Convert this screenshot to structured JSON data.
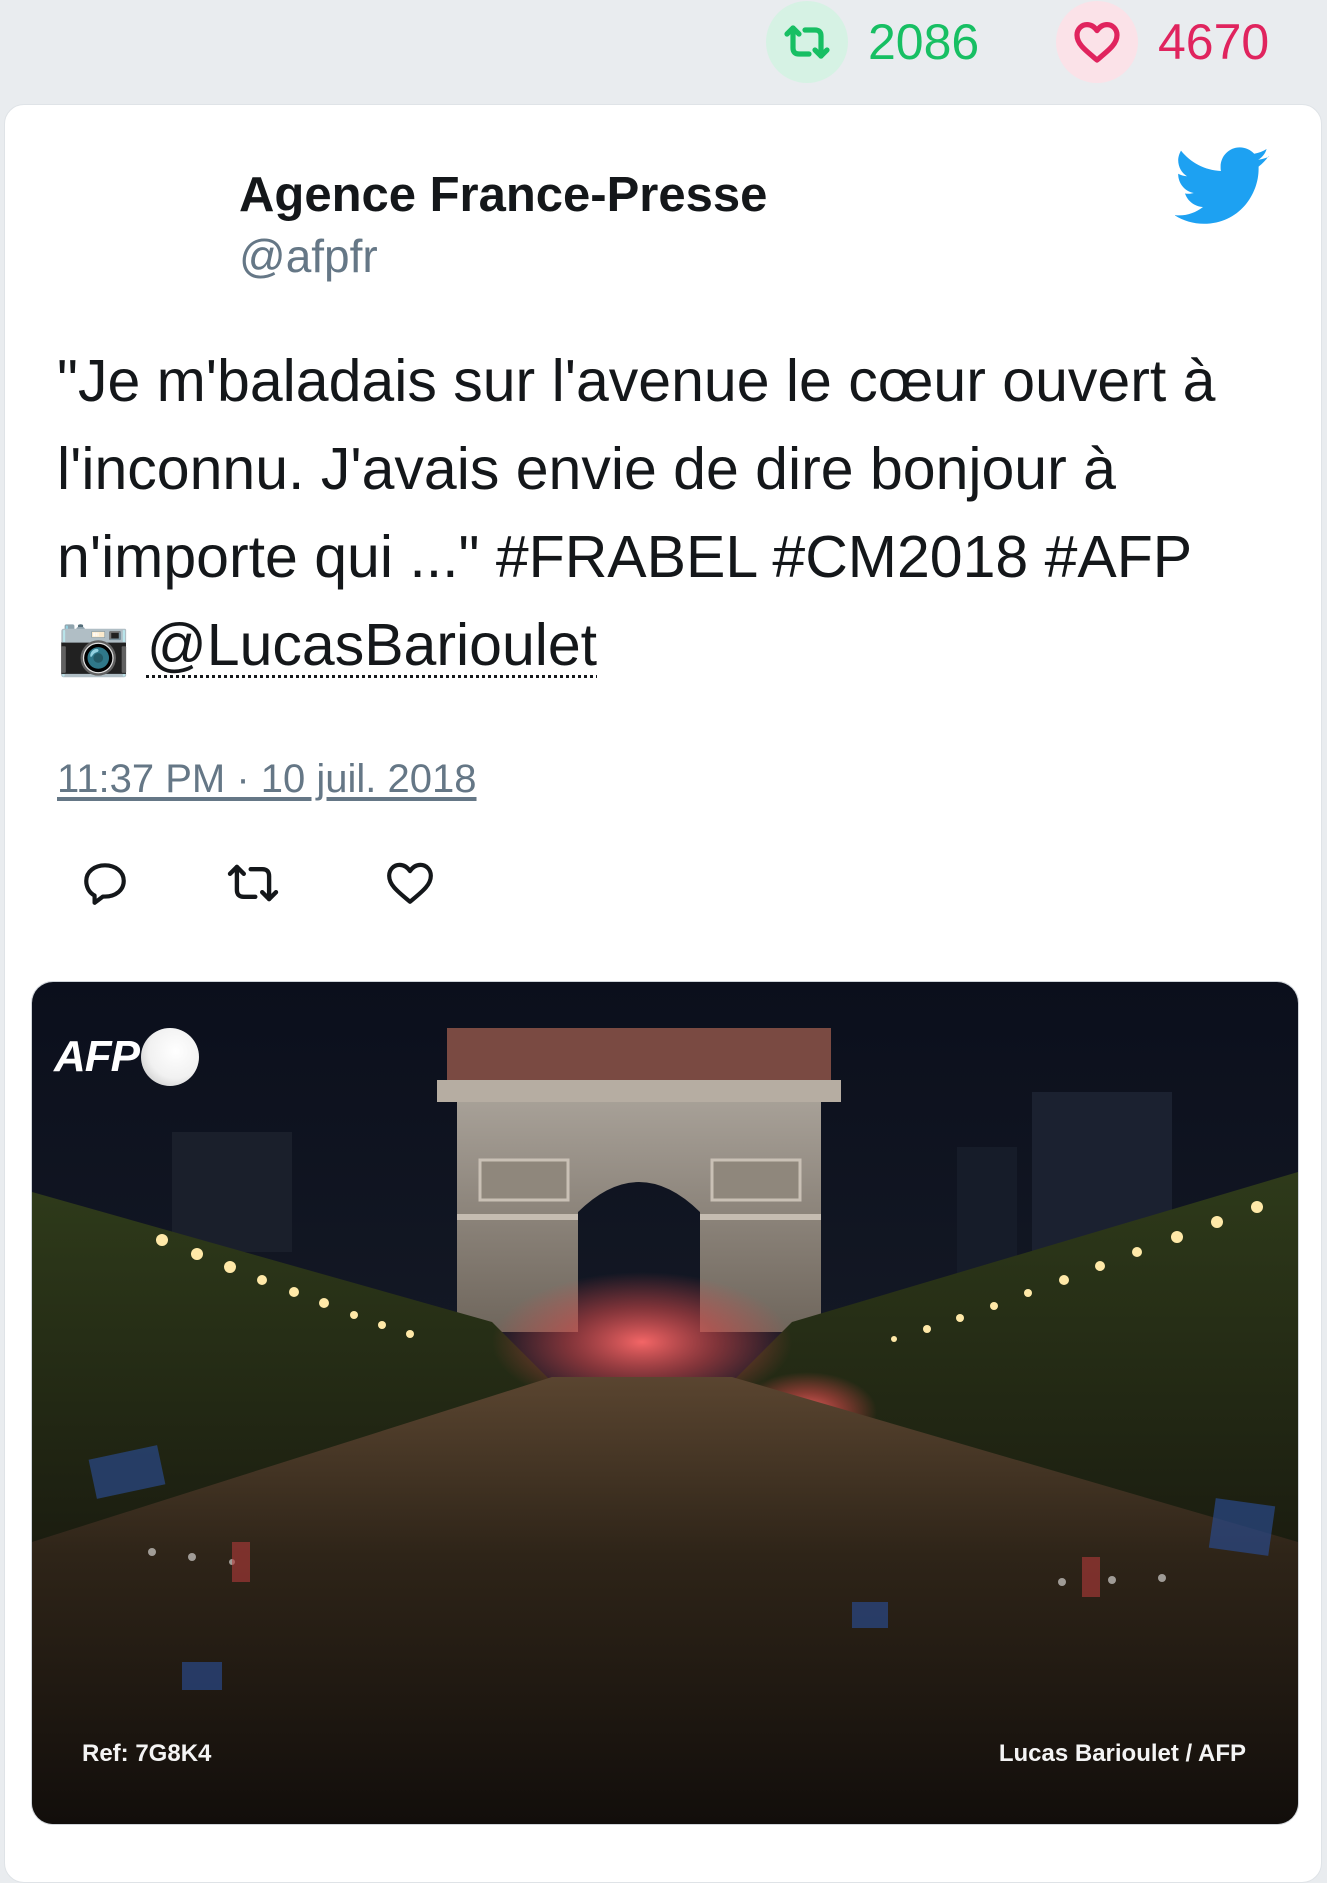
{
  "stats": {
    "retweet_count": "2086",
    "like_count": "4670"
  },
  "author": {
    "name": "Agence France-Presse",
    "handle": "@afpfr"
  },
  "tweet": {
    "text_main": "\"Je m'baladais sur l'avenue le cœur ouvert à l'inconnu. J'avais envie de dire bonjour à n'importe qui ...\" #FRABEL #CM2018 #AFP ",
    "camera_emoji": "📷",
    "mention": "@LucasBarioulet",
    "timestamp": "11:37 PM · 10 juil. 2018"
  },
  "photo": {
    "logo_text": "AFP",
    "ref": "Ref: 7G8K4",
    "credit": "Lucas Barioulet / AFP"
  },
  "icons": {
    "retweet": "retweet-icon",
    "like": "heart-icon",
    "reply": "reply-icon",
    "brand": "twitter-bird-icon"
  },
  "colors": {
    "retweet_green": "#17bf63",
    "like_red": "#e0245e",
    "twitter_blue": "#1da1f2",
    "secondary_text": "#657786"
  }
}
